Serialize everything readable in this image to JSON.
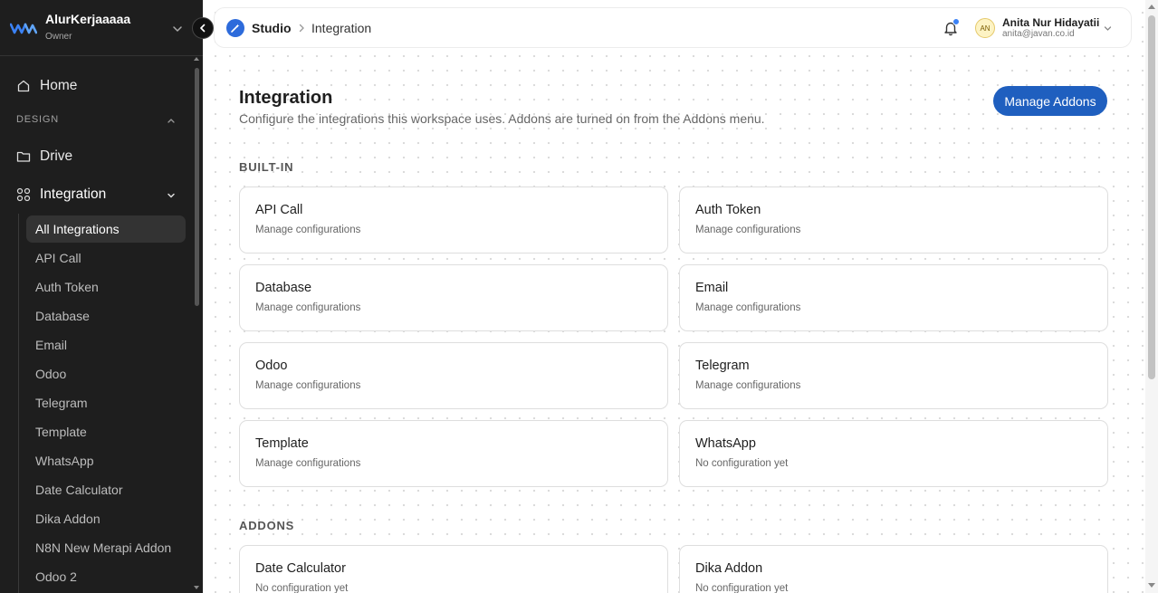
{
  "workspace": {
    "name": "AlurKerjaaaaa",
    "role": "Owner"
  },
  "sidebar": {
    "home_label": "Home",
    "section_label": "DESIGN",
    "drive_label": "Drive",
    "integration_label": "Integration",
    "sub_items": [
      {
        "label": "All Integrations",
        "active": true
      },
      {
        "label": "API Call"
      },
      {
        "label": "Auth Token"
      },
      {
        "label": "Database"
      },
      {
        "label": "Email"
      },
      {
        "label": "Odoo"
      },
      {
        "label": "Telegram"
      },
      {
        "label": "Template"
      },
      {
        "label": "WhatsApp"
      },
      {
        "label": "Date Calculator"
      },
      {
        "label": "Dika Addon"
      },
      {
        "label": "N8N New Merapi Addon"
      },
      {
        "label": "Odoo 2"
      }
    ]
  },
  "header": {
    "breadcrumb": {
      "root": "Studio",
      "current": "Integration"
    },
    "user": {
      "initials": "AN",
      "name": "Anita Nur Hidayatii",
      "email": "anita@javan.co.id"
    }
  },
  "page": {
    "title": "Integration",
    "subtitle": "Configure the integrations this workspace uses. Addons are turned on from the Addons menu.",
    "manage_button": "Manage Addons",
    "builtin_label": "BUILT-IN",
    "addons_label": "ADDONS",
    "builtin_cards": [
      {
        "title": "API Call",
        "status": "Manage configurations"
      },
      {
        "title": "Auth Token",
        "status": "Manage configurations"
      },
      {
        "title": "Database",
        "status": "Manage configurations"
      },
      {
        "title": "Email",
        "status": "Manage configurations"
      },
      {
        "title": "Odoo",
        "status": "Manage configurations"
      },
      {
        "title": "Telegram",
        "status": "Manage configurations"
      },
      {
        "title": "Template",
        "status": "Manage configurations"
      },
      {
        "title": "WhatsApp",
        "status": "No configuration yet"
      }
    ],
    "addon_cards": [
      {
        "title": "Date Calculator",
        "status": "No configuration yet"
      },
      {
        "title": "Dika Addon",
        "status": "No configuration yet"
      }
    ]
  },
  "colors": {
    "sidebar_bg": "#1e1e1e",
    "accent": "#1f5fbf",
    "notification_dot": "#3b82f6"
  },
  "icons": [
    "workspace-logo-icon",
    "chevron-down-icon",
    "chevron-left-icon",
    "home-icon",
    "folder-icon",
    "grid-icon",
    "studio-icon",
    "chevron-right-icon",
    "bell-icon"
  ]
}
